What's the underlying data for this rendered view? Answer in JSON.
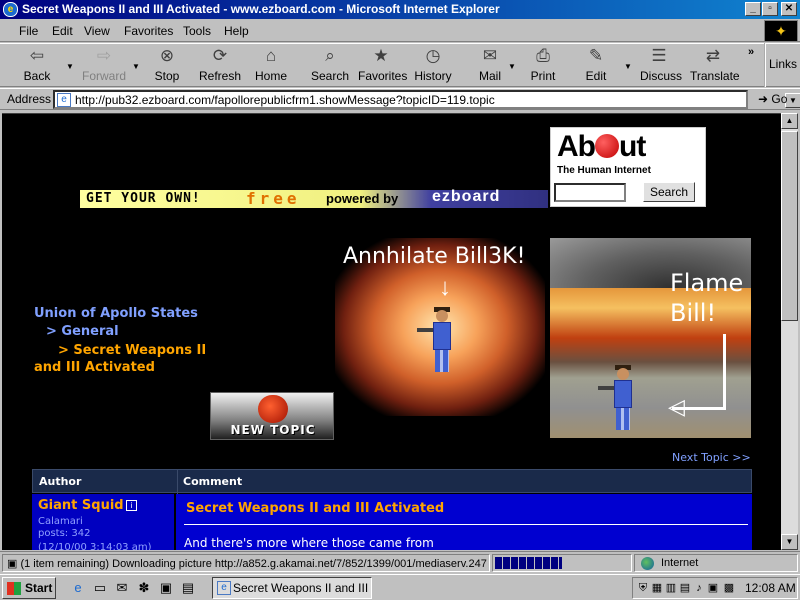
{
  "window": {
    "title": "Secret Weapons II and III Activated - www.ezboard.com - Microsoft Internet Explorer"
  },
  "menu": [
    "File",
    "Edit",
    "View",
    "Favorites",
    "Tools",
    "Help"
  ],
  "toolbar": {
    "back": "Back",
    "forward": "Forward",
    "stop": "Stop",
    "refresh": "Refresh",
    "home": "Home",
    "search": "Search",
    "favorites": "Favorites",
    "history": "History",
    "mail": "Mail",
    "print": "Print",
    "edit": "Edit",
    "discuss": "Discuss",
    "translate": "Translate",
    "links": "Links",
    "chevron": "»"
  },
  "address": {
    "label": "Address",
    "url": "http://pub32.ezboard.com/fapollorepublicfrm1.showMessage?topicID=119.topic",
    "go": "Go"
  },
  "about_ad": {
    "logo_a": "Ab",
    "logo_b": "ut",
    "tagline": "The Human Internet",
    "search_button": "Search",
    "search_value": ""
  },
  "banner": {
    "part1": "GET YOUR OWN!",
    "part2": "free",
    "part3": "powered by",
    "part4": "ezboard"
  },
  "breadcrumbs": {
    "root": "Union of Apollo States",
    "forum": "> General",
    "topic_line1": "> Secret Weapons II",
    "topic_line2": "and III Activated"
  },
  "images": {
    "left_caption": "Annhilate Bill3K!",
    "right_caption": "Flame Bill!",
    "new_topic": "NEW TOPIC"
  },
  "next_topic": "Next Topic >>",
  "table": {
    "header_author": "Author",
    "header_comment": "Comment",
    "rows": [
      {
        "author": "Giant Squid",
        "title": "Calamari",
        "posts": "posts: 342",
        "date": "(12/10/00 3:14:03 am)",
        "subject": "Secret Weapons II and III Activated",
        "body": "And there's more where those came from"
      }
    ]
  },
  "status": {
    "text": "(1 item remaining) Downloading picture http://a852.g.akamai.net/7/852/1399/001/mediaserv.247",
    "progress_fraction": 0.5,
    "zone": "Internet"
  },
  "taskbar": {
    "start": "Start",
    "task": "Secret Weapons II and III ...",
    "clock": "12:08 AM"
  },
  "colors": {
    "title_gradient_start": "#000080",
    "breadcrumb_root": "#80a0ff",
    "breadcrumb_topic": "#ffa500",
    "table_row": "#0000d0",
    "author_name": "#ffa500"
  }
}
